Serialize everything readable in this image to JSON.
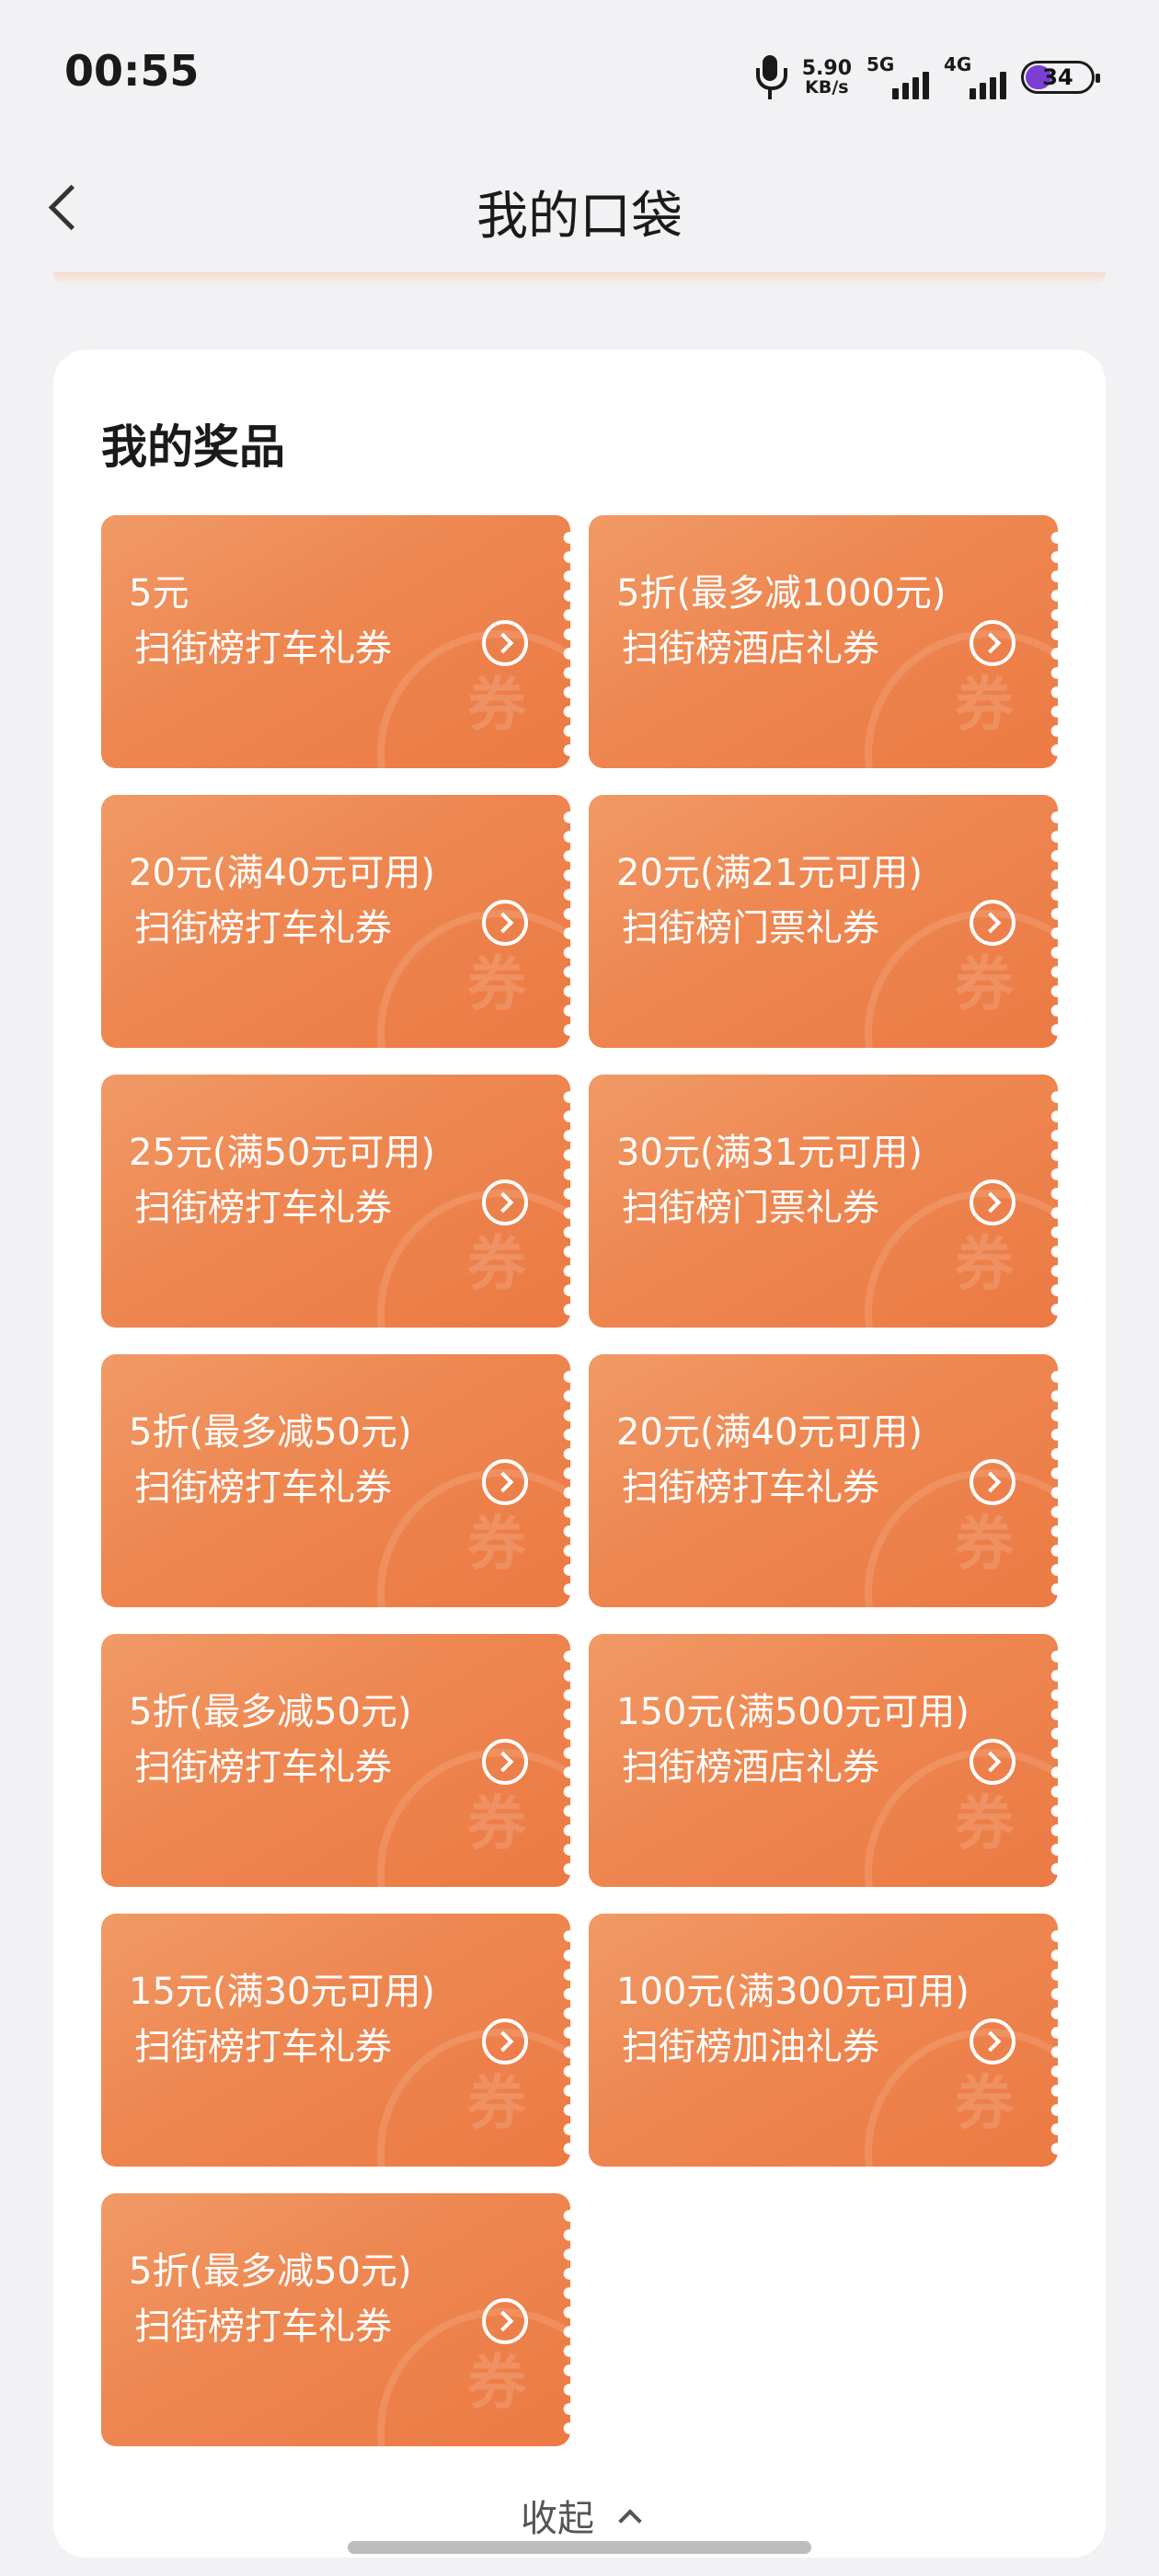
{
  "status_bar": {
    "time": "00:55",
    "net_speed_value": "5.90",
    "net_speed_unit": "KB/s",
    "sim1_label": "5G",
    "sim2_label": "4G",
    "battery_level": "34"
  },
  "header": {
    "title": "我的口袋"
  },
  "prizes": {
    "title": "我的奖品",
    "watermark_text": "券",
    "coupons": [
      {
        "amount": "5元",
        "name": "扫街榜打车礼券"
      },
      {
        "amount": "5折(最多减1000元)",
        "name": "扫街榜酒店礼券"
      },
      {
        "amount": "20元(满40元可用)",
        "name": "扫街榜打车礼券"
      },
      {
        "amount": "20元(满21元可用)",
        "name": "扫街榜门票礼券"
      },
      {
        "amount": "25元(满50元可用)",
        "name": "扫街榜打车礼券"
      },
      {
        "amount": "30元(满31元可用)",
        "name": "扫街榜门票礼券"
      },
      {
        "amount": "5折(最多减50元)",
        "name": "扫街榜打车礼券"
      },
      {
        "amount": "20元(满40元可用)",
        "name": "扫街榜打车礼券"
      },
      {
        "amount": "5折(最多减50元)",
        "name": "扫街榜打车礼券"
      },
      {
        "amount": "150元(满500元可用)",
        "name": "扫街榜酒店礼券"
      },
      {
        "amount": "15元(满30元可用)",
        "name": "扫街榜打车礼券"
      },
      {
        "amount": "100元(满300元可用)",
        "name": "扫街榜加油礼券"
      },
      {
        "amount": "5折(最多减50元)",
        "name": "扫街榜打车礼券"
      }
    ],
    "collapse_label": "收起"
  },
  "colors": {
    "coupon_orange": "#ee8650",
    "page_bg": "#f2f2f5"
  }
}
